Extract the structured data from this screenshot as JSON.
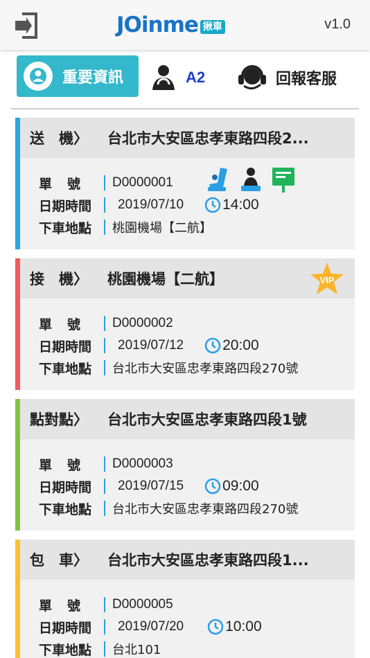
{
  "header": {
    "logo_text": "JOinme",
    "logo_badge": "揪車",
    "version": "v1.0",
    "exit_icon": "exit-icon"
  },
  "tabs": {
    "info_label": "重要資訊",
    "driver_label": "A2",
    "support_label": "回報客服"
  },
  "colors": {
    "accent": "#34b8cc",
    "blue_bar": "#29a6e3",
    "red_bar": "#f05a5a",
    "green_bar": "#7cc442",
    "yellow_bar": "#fbc02d",
    "separator": "#2aa0d8"
  },
  "labels": {
    "order_no": "單號",
    "datetime": "日期時間",
    "dropoff": "下車地點"
  },
  "orders": [
    {
      "type": "送　機〉",
      "destination": "台北市大安區忠孝東路四段2...",
      "order_no": "D0000001",
      "date": "2019/07/10",
      "time": "14:00",
      "dropoff": "桃園機場【二航】",
      "bar_color": "#29a6e3",
      "icons": [
        "child-seat-icon",
        "booster-seat-icon",
        "sign-board-icon"
      ]
    },
    {
      "type": "接　機〉",
      "destination": "桃園機場【二航】",
      "order_no": "D0000002",
      "date": "2019/07/12",
      "time": "20:00",
      "dropoff": "台北市大安區忠孝東路四段270號",
      "bar_color": "#f05a5a",
      "vip": "VIP"
    },
    {
      "type": "點對點〉",
      "destination": "台北市大安區忠孝東路四段1號",
      "order_no": "D0000003",
      "date": "2019/07/15",
      "time": "09:00",
      "dropoff": "台北市大安區忠孝東路四段270號",
      "bar_color": "#7cc442"
    },
    {
      "type": "包　車〉",
      "destination": "台北市大安區忠孝東路四段1...",
      "order_no": "D0000005",
      "date": "2019/07/20",
      "time": "10:00",
      "dropoff": "台北101",
      "bar_color": "#fbc02d"
    }
  ]
}
